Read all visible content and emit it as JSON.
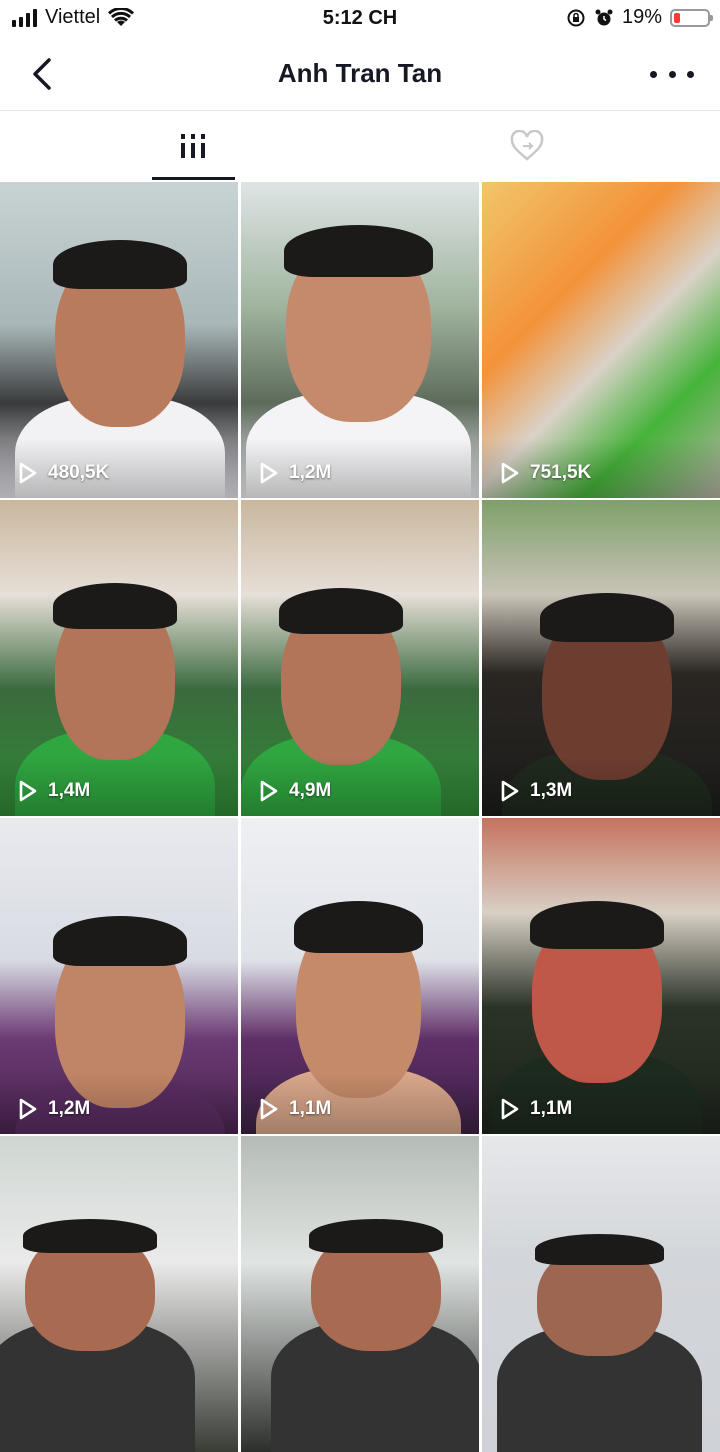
{
  "status": {
    "carrier": "Viettel",
    "time": "5:12 CH",
    "battery_percent": "19%",
    "battery_level": 0.19
  },
  "header": {
    "title": "Anh Tran Tan",
    "back_icon": "chevron-left-icon",
    "more_icon": "more-horizontal-icon"
  },
  "tabs": [
    {
      "icon": "grid-icon",
      "active": true
    },
    {
      "icon": "liked-heart-icon",
      "active": false
    }
  ],
  "videos": [
    {
      "views": "480,5K"
    },
    {
      "views": "1,2M"
    },
    {
      "views": "751,5K"
    },
    {
      "views": "1,4M"
    },
    {
      "views": "4,9M"
    },
    {
      "views": "1,3M"
    },
    {
      "views": "1,2M"
    },
    {
      "views": "1,1M"
    },
    {
      "views": "1,1M"
    },
    {
      "views": ""
    },
    {
      "views": ""
    },
    {
      "views": ""
    }
  ],
  "colors": {
    "text": "#161823",
    "battery_low": "#ff3b30",
    "divider": "#e6e6e6"
  }
}
